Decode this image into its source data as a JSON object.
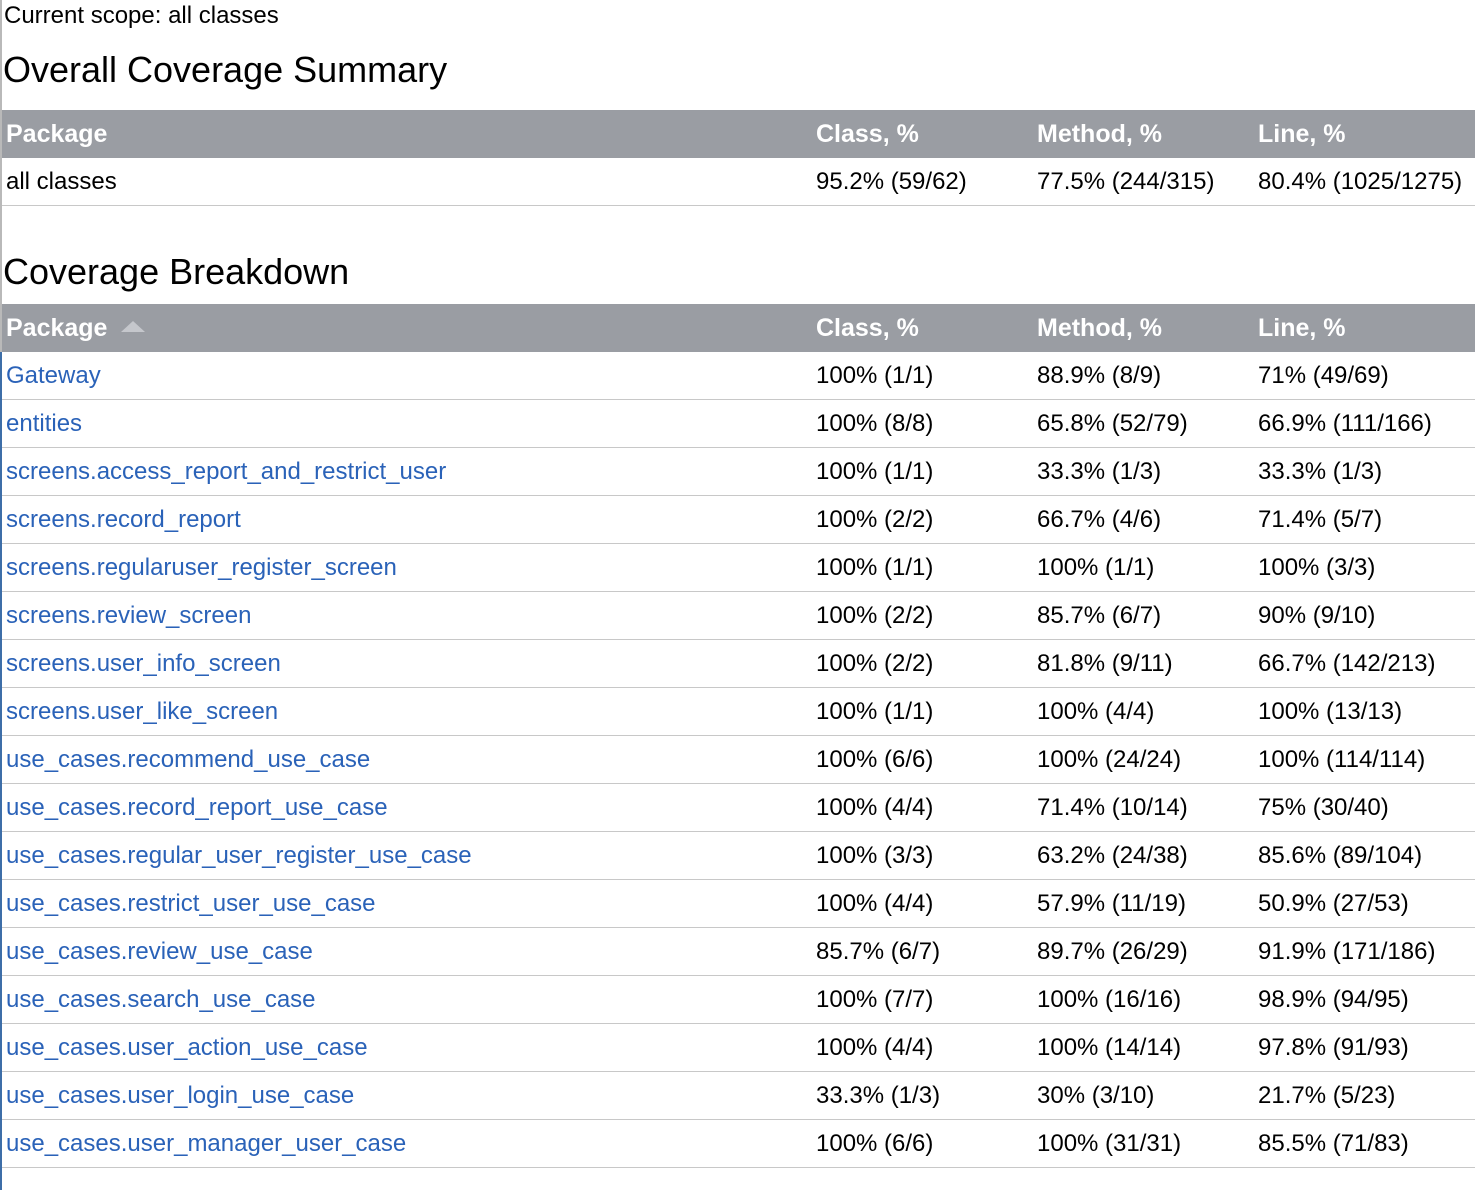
{
  "scope": {
    "label": "Current scope: all classes"
  },
  "summary": {
    "title": "Overall Coverage Summary",
    "headers": {
      "package": "Package",
      "class": "Class, %",
      "method": "Method, %",
      "line": "Line, %"
    },
    "row": {
      "package": "all classes",
      "class": "95.2% (59/62)",
      "method": "77.5% (244/315)",
      "line": "80.4% (1025/1275)"
    }
  },
  "breakdown": {
    "title": "Coverage Breakdown",
    "headers": {
      "package": "Package",
      "class": "Class, %",
      "method": "Method, %",
      "line": "Line, %"
    },
    "sort_icon": "sort-ascending-icon",
    "link_color": "#2a62b8",
    "header_bg": "#9a9da3",
    "rows": [
      {
        "package": "Gateway",
        "class": "100% (1/1)",
        "method": "88.9% (8/9)",
        "line": "71% (49/69)"
      },
      {
        "package": "entities",
        "class": "100% (8/8)",
        "method": "65.8% (52/79)",
        "line": "66.9% (111/166)"
      },
      {
        "package": "screens.access_report_and_restrict_user",
        "class": "100% (1/1)",
        "method": "33.3% (1/3)",
        "line": "33.3% (1/3)"
      },
      {
        "package": "screens.record_report",
        "class": "100% (2/2)",
        "method": "66.7% (4/6)",
        "line": "71.4% (5/7)"
      },
      {
        "package": "screens.regularuser_register_screen",
        "class": "100% (1/1)",
        "method": "100% (1/1)",
        "line": "100% (3/3)"
      },
      {
        "package": "screens.review_screen",
        "class": "100% (2/2)",
        "method": "85.7% (6/7)",
        "line": "90% (9/10)"
      },
      {
        "package": "screens.user_info_screen",
        "class": "100% (2/2)",
        "method": "81.8% (9/11)",
        "line": "66.7% (142/213)"
      },
      {
        "package": "screens.user_like_screen",
        "class": "100% (1/1)",
        "method": "100% (4/4)",
        "line": "100% (13/13)"
      },
      {
        "package": "use_cases.recommend_use_case",
        "class": "100% (6/6)",
        "method": "100% (24/24)",
        "line": "100% (114/114)"
      },
      {
        "package": "use_cases.record_report_use_case",
        "class": "100% (4/4)",
        "method": "71.4% (10/14)",
        "line": "75% (30/40)"
      },
      {
        "package": "use_cases.regular_user_register_use_case",
        "class": "100% (3/3)",
        "method": "63.2% (24/38)",
        "line": "85.6% (89/104)"
      },
      {
        "package": "use_cases.restrict_user_use_case",
        "class": "100% (4/4)",
        "method": "57.9% (11/19)",
        "line": "50.9% (27/53)"
      },
      {
        "package": "use_cases.review_use_case",
        "class": "85.7% (6/7)",
        "method": "89.7% (26/29)",
        "line": "91.9% (171/186)"
      },
      {
        "package": "use_cases.search_use_case",
        "class": "100% (7/7)",
        "method": "100% (16/16)",
        "line": "98.9% (94/95)"
      },
      {
        "package": "use_cases.user_action_use_case",
        "class": "100% (4/4)",
        "method": "100% (14/14)",
        "line": "97.8% (91/93)"
      },
      {
        "package": "use_cases.user_login_use_case",
        "class": "33.3% (1/3)",
        "method": "30% (3/10)",
        "line": "21.7% (5/23)"
      },
      {
        "package": "use_cases.user_manager_user_case",
        "class": "100% (6/6)",
        "method": "100% (31/31)",
        "line": "85.5% (71/83)"
      }
    ]
  }
}
